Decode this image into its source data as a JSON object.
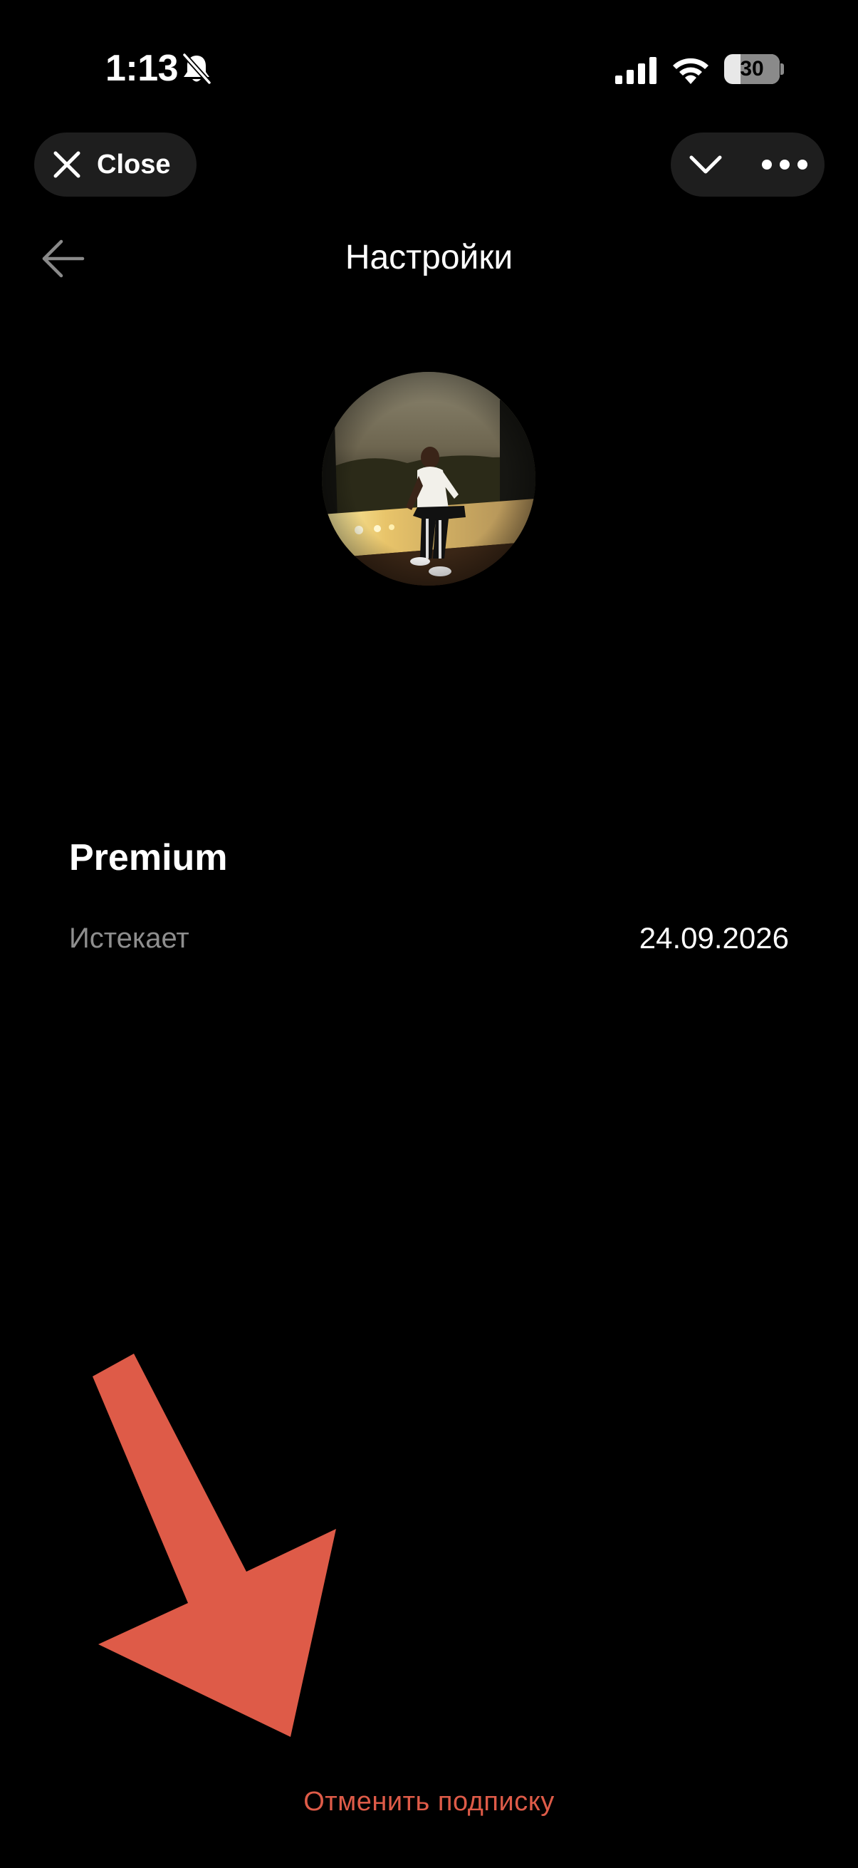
{
  "status_bar": {
    "time": "1:13",
    "battery_percent": "30",
    "battery_level": 0.3,
    "icons": [
      "bell-slash-icon",
      "cellular-signal-icon",
      "wifi-icon",
      "battery-icon"
    ]
  },
  "top_bar": {
    "close_label": "Close",
    "icons": [
      "close-icon",
      "chevron-down-icon",
      "more-icon"
    ]
  },
  "header": {
    "title": "Настройки",
    "back_icon": "arrow-left-icon"
  },
  "subscription": {
    "plan": "Premium",
    "expires_label": "Истекает",
    "expires_value": "24.09.2026"
  },
  "actions": {
    "cancel_label": "Отменить подписку"
  },
  "colors": {
    "background": "#000000",
    "pill_background": "#1e1e1e",
    "accent_red": "#de5b48",
    "secondary_text": "#8e8e8e"
  }
}
